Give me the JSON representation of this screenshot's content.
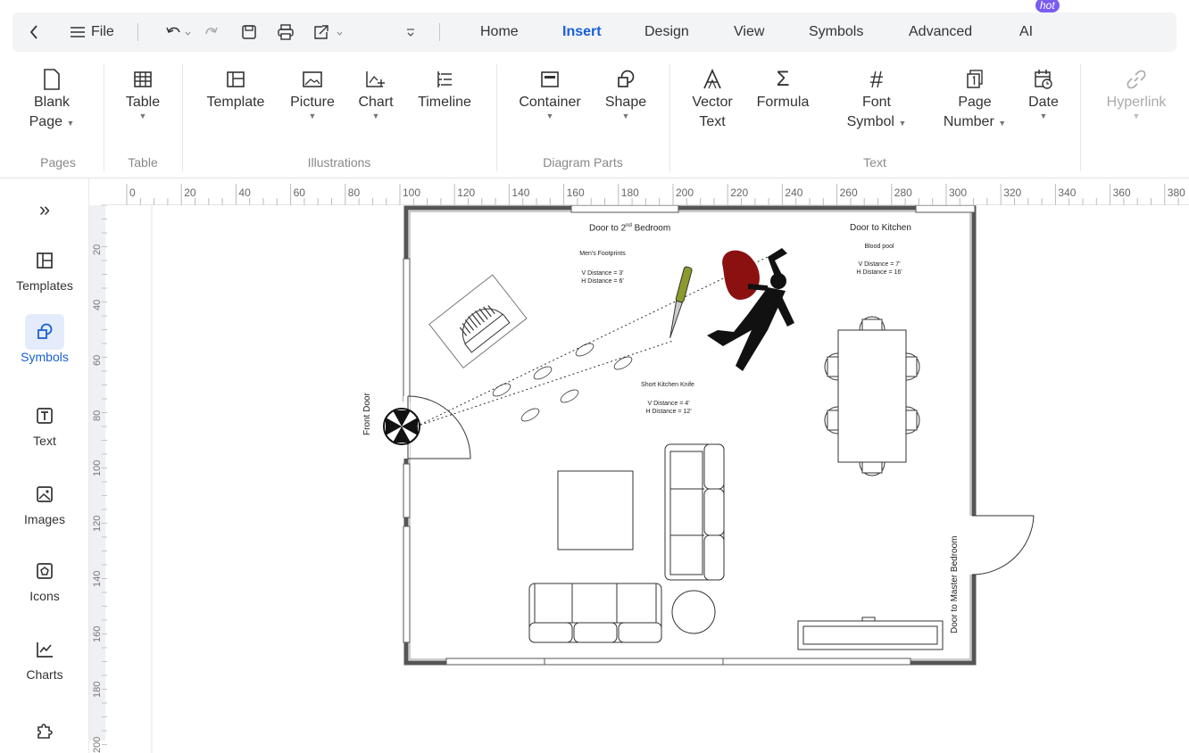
{
  "quickbar": {
    "file_label": "File",
    "tabs": [
      "Home",
      "Insert",
      "Design",
      "View",
      "Symbols",
      "Advanced",
      "AI"
    ],
    "hot_badge": "hot"
  },
  "ribbon": {
    "buttons": {
      "blank_page": [
        "Blank",
        "Page"
      ],
      "table": "Table",
      "template": "Template",
      "picture": "Picture",
      "chart": "Chart",
      "timeline": "Timeline",
      "container": "Container",
      "shape": "Shape",
      "vector_text": [
        "Vector",
        "Text"
      ],
      "formula": "Formula",
      "font_symbol": [
        "Font",
        "Symbol"
      ],
      "page_number": [
        "Page",
        "Number"
      ],
      "date": "Date",
      "hyperlink": "Hyperlink"
    },
    "groups": [
      "Pages",
      "Table",
      "Illustrations",
      "Diagram Parts",
      "Text"
    ]
  },
  "sidebar": {
    "items": [
      "Templates",
      "Symbols",
      "Text",
      "Images",
      "Icons",
      "Charts"
    ]
  },
  "ruler": {
    "top": [
      "0",
      "20",
      "40",
      "60",
      "80",
      "100",
      "120",
      "140",
      "160",
      "180",
      "200",
      "220",
      "240",
      "260",
      "280",
      "300",
      "320",
      "340",
      "360",
      "380"
    ],
    "left": [
      "20",
      "40",
      "60",
      "80",
      "100",
      "120",
      "140",
      "160",
      "180",
      "200"
    ]
  },
  "plan": {
    "door_bedroom2_prefix": "Door to 2",
    "door_bedroom2_sup": "nd",
    "door_bedroom2_suffix": " Bedroom",
    "door_kitchen": "Door to Kitchen",
    "blood_pool": "Blood pool",
    "blood_v": "V Distance = 7'",
    "blood_h": "H Distance = 16'",
    "footprints": "Men's Footprints",
    "foot_v": "V Distance = 3'",
    "foot_h": "H Distance = 6'",
    "knife": "Short Kitchen Knife",
    "knife_v": "V Distance = 4'",
    "knife_h": "H Distance = 12'",
    "front_door": "Front Door",
    "master_door": "Door to Master Bedroom"
  }
}
